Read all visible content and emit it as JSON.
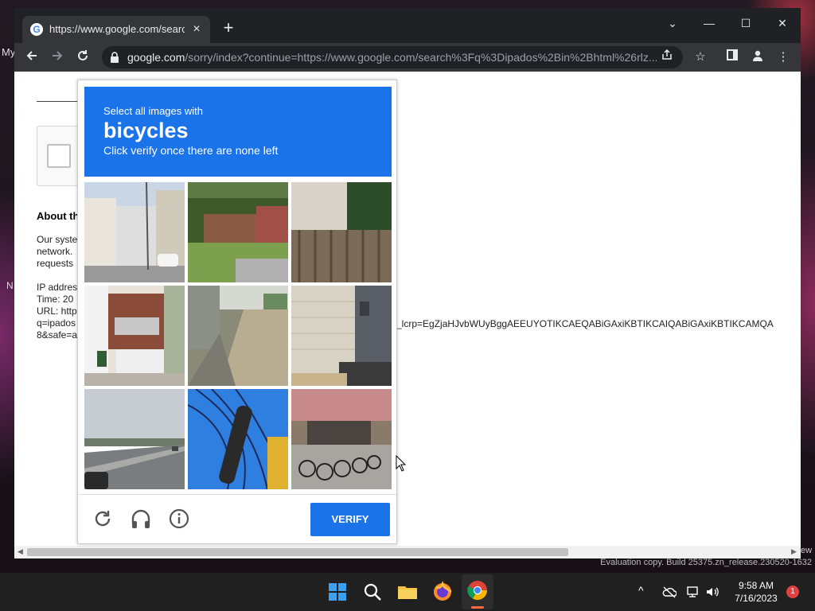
{
  "desktop": {
    "left_label": "My",
    "left_label2": "N",
    "right_label": "ew",
    "evaluation_text": "Evaluation copy. Build 25375.zn_release.230520-1632"
  },
  "browser": {
    "tab": {
      "title": "https://www.google.com/search?",
      "favicon": "G"
    },
    "new_tab": "+",
    "window_controls": {
      "tab_search": "⌄",
      "minimize": "—",
      "maximize": "☐",
      "close": "✕"
    },
    "address": {
      "host": "google.com",
      "path": "/sorry/index?continue=https://www.google.com/search%3Fq%3Dipados%2Bin%2Bhtml%26rlz..."
    }
  },
  "page": {
    "about_heading": "About th",
    "para1": [
      "Our syste",
      "network.",
      "requests"
    ],
    "para2": [
      "IP addres",
      "Time: 20",
      "URL: http",
      "q=ipados",
      "8&safe=a"
    ],
    "lcrp_text": "_lcrp=EgZjaHJvbWUyBggAEEUYOTIKCAEQABiGAxiKBTIKCAIQABiGAxiKBTIKCAMQA"
  },
  "captcha": {
    "instruction_line1": "Select all images with",
    "target": "bicycles",
    "instruction_line3": "Click verify once there are none left",
    "verify_label": "VERIFY",
    "tiles": [
      "house-street-tile",
      "brick-house-tile",
      "wooden-fence-tile",
      "apartment-balcony-tile",
      "alley-tile",
      "building-wall-tile",
      "highway-tile",
      "bicycle-closeup-tile",
      "parked-bicycles-tile"
    ]
  },
  "taskbar": {
    "time": "9:58 AM",
    "date": "7/16/2023",
    "notifications": "1"
  },
  "colors": {
    "accent": "#1a73e8",
    "chrome_dark": "#202124",
    "chrome_toolbar": "#35363a"
  }
}
